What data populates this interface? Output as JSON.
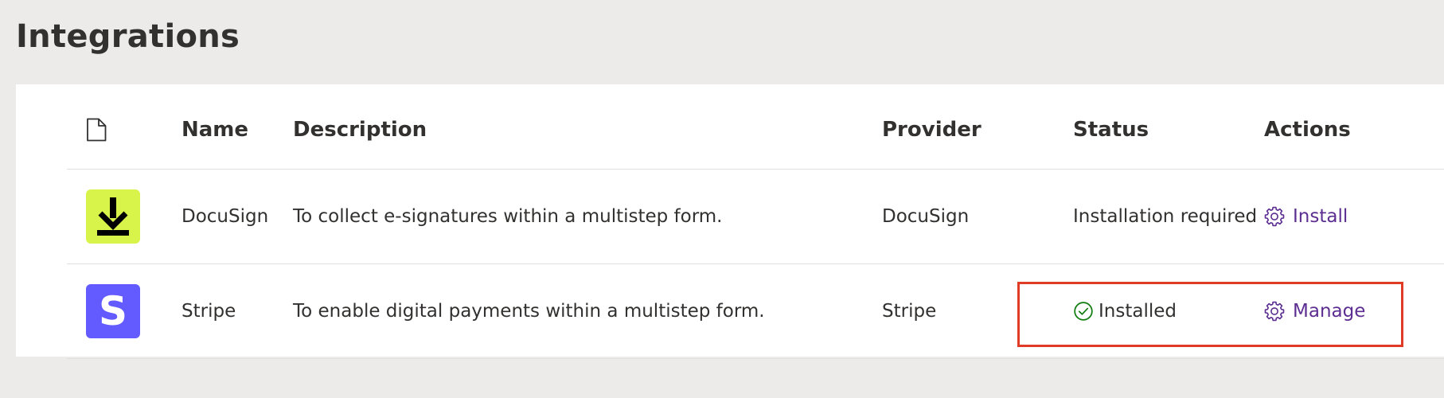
{
  "page": {
    "title": "Integrations"
  },
  "table": {
    "columns": {
      "icon": "file-icon",
      "name": "Name",
      "description": "Description",
      "provider": "Provider",
      "status": "Status",
      "actions": "Actions"
    },
    "rows": [
      {
        "logo": "download-arrow-icon",
        "logo_color": "#d8f34a",
        "name": "DocuSign",
        "description": "To collect e-signatures within a multistep form.",
        "provider": "DocuSign",
        "status": "Installation required",
        "action_label": "Install",
        "action_icon": "gear-icon"
      },
      {
        "logo": "stripe-s-icon",
        "logo_letter": "S",
        "logo_color": "#635bff",
        "name": "Stripe",
        "description": "To enable digital payments within a multistep form.",
        "provider": "Stripe",
        "status": "Installed",
        "status_icon": "check-circle-icon",
        "action_label": "Manage",
        "action_icon": "gear-icon"
      }
    ]
  },
  "colors": {
    "background": "#edebe9",
    "link": "#5c2e91",
    "success": "#107c10",
    "highlight": "#e03b24"
  }
}
